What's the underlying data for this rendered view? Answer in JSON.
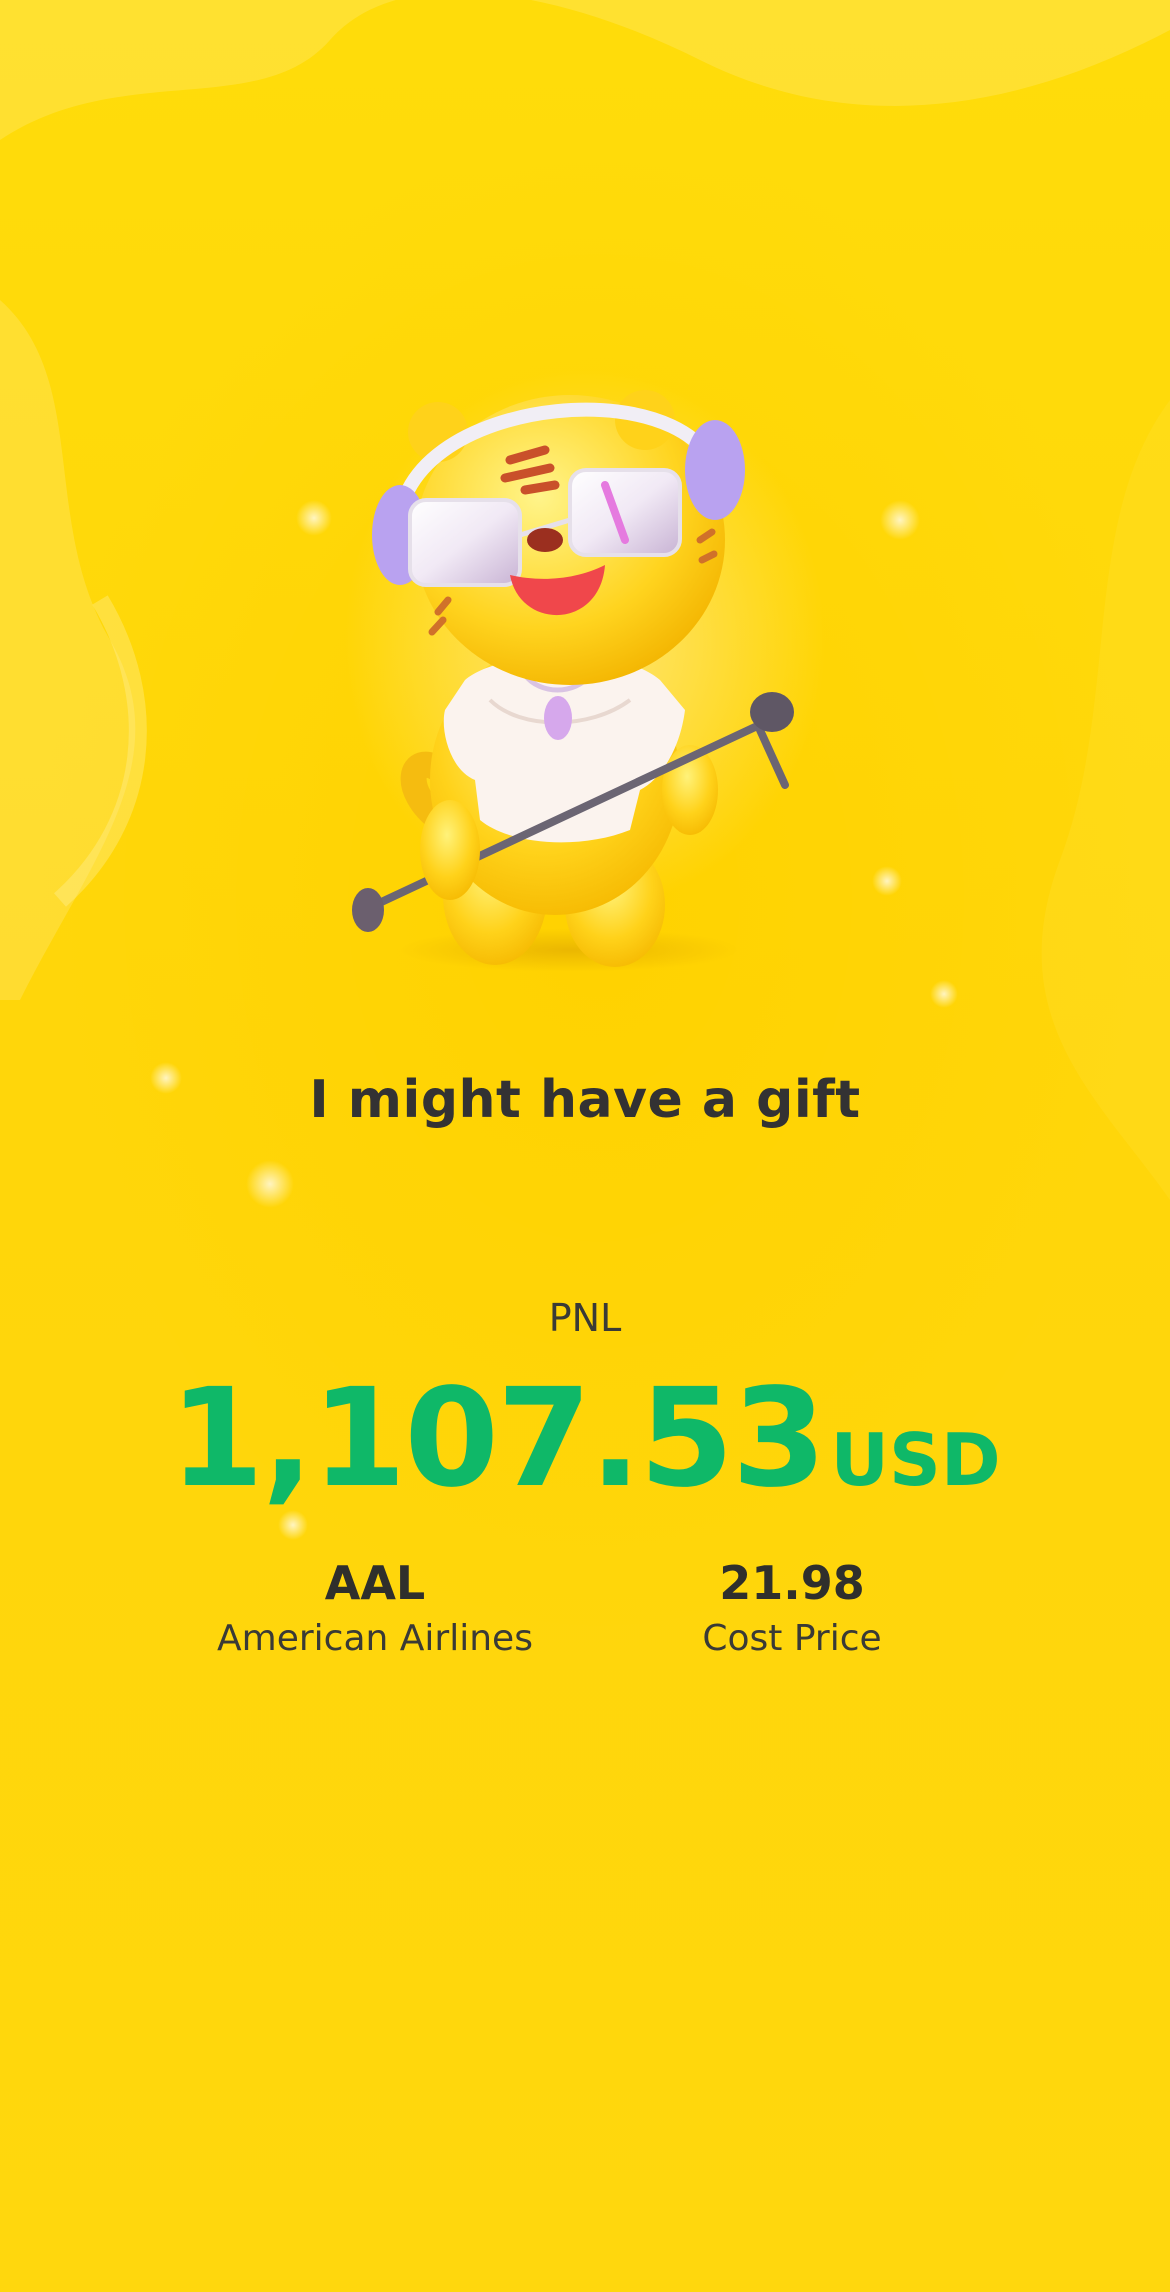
{
  "mascot": {
    "icon": "tiger-singer-icon",
    "colors": {
      "body": "#ffd21a",
      "shirt": "#fbf3ee",
      "headphones": "#b9a2f0",
      "mouth": "#f0474b"
    }
  },
  "gift_title": "I might have a gift",
  "pnl": {
    "label": "PNL",
    "value": "1,107.53",
    "unit": "USD"
  },
  "stock": {
    "ticker": "AAL",
    "name": "American Airlines"
  },
  "cost": {
    "value": "21.98",
    "label": "Cost Price"
  },
  "colors": {
    "background": "#ffd809",
    "profit_green": "#0fb868",
    "text_dark": "#333233"
  }
}
